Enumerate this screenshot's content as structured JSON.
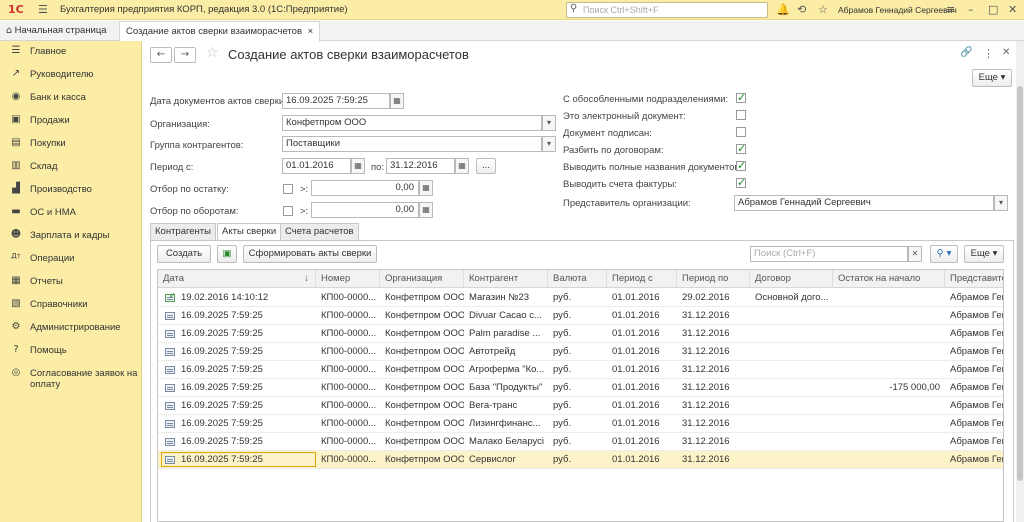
{
  "titlebar": {
    "logo": "1С",
    "app_title": "Бухгалтерия предприятия КОРП, редакция 3.0  (1С:Предприятие)",
    "search_placeholder": "Поиск Ctrl+Shift+F",
    "user": "Абрамов Геннадий Сергеевич"
  },
  "tabs": {
    "home": "Начальная страница",
    "current": "Создание актов сверки взаиморасчетов",
    "close": "×"
  },
  "sidebar": {
    "items": [
      {
        "icon": "menu-icon",
        "label": "Главное"
      },
      {
        "icon": "chart-icon",
        "label": "Руководителю"
      },
      {
        "icon": "bank-icon",
        "label": "Банк и касса"
      },
      {
        "icon": "bag-icon",
        "label": "Продажи"
      },
      {
        "icon": "cart-icon",
        "label": "Покупки"
      },
      {
        "icon": "warehouse-icon",
        "label": "Склад"
      },
      {
        "icon": "factory-icon",
        "label": "Производство"
      },
      {
        "icon": "truck-icon",
        "label": "ОС и НМА"
      },
      {
        "icon": "people-icon",
        "label": "Зарплата и кадры"
      },
      {
        "icon": "operations-icon",
        "label": "Операции"
      },
      {
        "icon": "reports-icon",
        "label": "Отчеты"
      },
      {
        "icon": "book-icon",
        "label": "Справочники"
      },
      {
        "icon": "gear-icon",
        "label": "Администрирование"
      },
      {
        "icon": "help-icon",
        "label": "Помощь"
      },
      {
        "icon": "coins-icon",
        "label": "Согласование заявок на оплату"
      }
    ]
  },
  "form": {
    "title": "Создание актов сверки взаиморасчетов",
    "more": "Еще",
    "date_label": "Дата документов актов сверки:",
    "date_value": "16.09.2025  7:59:25",
    "org_label": "Организация:",
    "org_value": "Конфетпром ООО",
    "group_label": "Группа контрагентов:",
    "group_value": "Поставщики",
    "period_label": "Период с:",
    "period_from": "01.01.2016",
    "period_to_label": "по:",
    "period_to": "31.12.2016",
    "dots": "...",
    "balance_label": "Отбор по остатку:",
    "turnover_label": "Отбор по оборотам:",
    "gt": ">:",
    "balance_value": "0,00",
    "turnover_value": "0,00",
    "checks": [
      {
        "label": "С обособленными подразделениями:",
        "on": true
      },
      {
        "label": "Это электронный документ:",
        "on": false
      },
      {
        "label": "Документ подписан:",
        "on": false
      },
      {
        "label": "Разбить по договорам:",
        "on": true
      },
      {
        "label": "Выводить полные названия документов:",
        "on": true
      },
      {
        "label": "Выводить счета фактуры:",
        "on": true
      }
    ],
    "rep_label": "Представитель организации:",
    "rep_value": "Абрамов Геннадий Сергеевич"
  },
  "page_tabs": [
    "Контрагенты",
    "Акты сверки",
    "Счета расчетов"
  ],
  "list": {
    "create": "Создать",
    "generate": "Сформировать акты сверки",
    "search_placeholder": "Поиск (Ctrl+F)",
    "more": "Еще",
    "columns": [
      "Дата",
      "Номер",
      "Организация",
      "Контрагент",
      "Валюта",
      "Период с",
      "Период по",
      "Договор",
      "Остаток на начало",
      "Представите"
    ],
    "sort_arrow": "↓",
    "rows": [
      {
        "posted": true,
        "c": [
          "19.02.2016 14:10:12",
          "КП00-0000...",
          "Конфетпром ООО",
          "Магазин №23",
          "руб.",
          "01.01.2016",
          "29.02.2016",
          "Основной дого...",
          "",
          "Абрамов Ген"
        ]
      },
      {
        "posted": false,
        "c": [
          "16.09.2025 7:59:25",
          "КП00-0000...",
          "Конфетпром ООО",
          "Divuar Cacao c...",
          "руб.",
          "01.01.2016",
          "31.12.2016",
          "",
          "",
          "Абрамов Ген"
        ]
      },
      {
        "posted": false,
        "c": [
          "16.09.2025 7:59:25",
          "КП00-0000...",
          "Конфетпром ООО",
          "Palm paradise ...",
          "руб.",
          "01.01.2016",
          "31.12.2016",
          "",
          "",
          "Абрамов Ген"
        ]
      },
      {
        "posted": false,
        "c": [
          "16.09.2025 7:59:25",
          "КП00-0000...",
          "Конфетпром ООО",
          "Автотрейд",
          "руб.",
          "01.01.2016",
          "31.12.2016",
          "",
          "",
          "Абрамов Ген"
        ]
      },
      {
        "posted": false,
        "c": [
          "16.09.2025 7:59:25",
          "КП00-0000...",
          "Конфетпром ООО",
          "Агроферма \"Ко...",
          "руб.",
          "01.01.2016",
          "31.12.2016",
          "",
          "",
          "Абрамов Ген"
        ]
      },
      {
        "posted": false,
        "c": [
          "16.09.2025 7:59:25",
          "КП00-0000...",
          "Конфетпром ООО",
          "База \"Продукты\"",
          "руб.",
          "01.01.2016",
          "31.12.2016",
          "",
          "-175 000,00",
          "Абрамов Ген"
        ]
      },
      {
        "posted": false,
        "c": [
          "16.09.2025 7:59:25",
          "КП00-0000...",
          "Конфетпром ООО",
          "Вега-транс",
          "руб.",
          "01.01.2016",
          "31.12.2016",
          "",
          "",
          "Абрамов Ген"
        ]
      },
      {
        "posted": false,
        "c": [
          "16.09.2025 7:59:25",
          "КП00-0000...",
          "Конфетпром ООО",
          "Лизингфинанс...",
          "руб.",
          "01.01.2016",
          "31.12.2016",
          "",
          "",
          "Абрамов Ген"
        ]
      },
      {
        "posted": false,
        "c": [
          "16.09.2025 7:59:25",
          "КП00-0000...",
          "Конфетпром ООО",
          "Малако Беларусі",
          "руб.",
          "01.01.2016",
          "31.12.2016",
          "",
          "",
          "Абрамов Ген"
        ]
      },
      {
        "posted": false,
        "c": [
          "16.09.2025 7:59:25",
          "КП00-0000...",
          "Конфетпром ООО",
          "Сервислог",
          "руб.",
          "01.01.2016",
          "31.12.2016",
          "",
          "",
          "Абрамов Ген"
        ]
      }
    ]
  }
}
